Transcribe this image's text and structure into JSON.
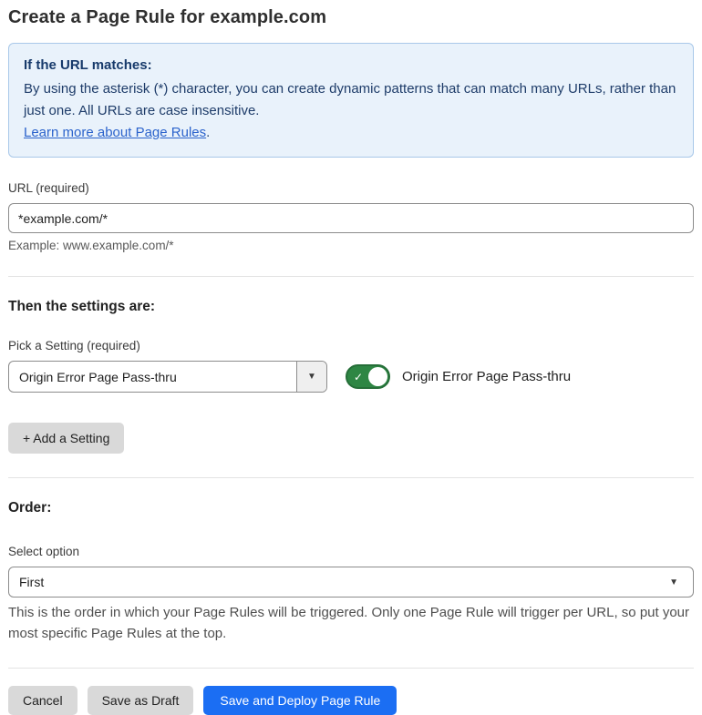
{
  "page": {
    "title": "Create a Page Rule for example.com"
  },
  "info_box": {
    "heading": "If the URL matches:",
    "body": "By using the asterisk (*) character, you can create dynamic patterns that can match many URLs, rather than just one. All URLs are case insensitive.",
    "link_label": "Learn more about Page Rules",
    "link_suffix": "."
  },
  "url_field": {
    "label": "URL (required)",
    "value": "*example.com/*",
    "helper": "Example: www.example.com/*"
  },
  "settings_section": {
    "heading": "Then the settings are:",
    "picker_label": "Pick a Setting (required)",
    "picker_value": "Origin Error Page Pass-thru",
    "caret_glyph": "▼",
    "toggle": {
      "state": "on",
      "check_glyph": "✓",
      "label": "Origin Error Page Pass-thru"
    },
    "add_button_label": "+ Add a Setting"
  },
  "order_section": {
    "heading": "Order:",
    "select_label": "Select option",
    "select_value": "First",
    "caret_glyph": "▼",
    "helper": "This is the order in which your Page Rules will be triggered. Only one Page Rule will trigger per URL, so put your most specific Page Rules at the top."
  },
  "footer": {
    "cancel_label": "Cancel",
    "save_draft_label": "Save as Draft",
    "save_deploy_label": "Save and Deploy Page Rule"
  },
  "colors": {
    "primary_blue": "#1b6ef3",
    "info_bg": "#e9f2fb",
    "info_border": "#a9c8e9",
    "info_text": "#1e3c69",
    "link_blue": "#2b63cc",
    "toggle_green": "#2e8644",
    "button_gray": "#d9d9d9"
  }
}
